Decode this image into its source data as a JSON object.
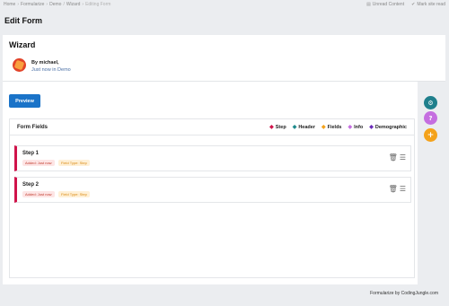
{
  "breadcrumb": [
    "Home",
    "Formularize",
    "Demo",
    "Wizard",
    "Editing Form"
  ],
  "topbar": {
    "unread": "Unread Content",
    "mark_read": "Mark site read"
  },
  "page_title": "Edit Form",
  "form": {
    "title": "Wizard",
    "author": "By michael,",
    "meta": "Just now in Demo"
  },
  "preview_label": "Preview",
  "fields_panel": {
    "title": "Form Fields",
    "legend": [
      {
        "label": "Step",
        "color": "#d0134a"
      },
      {
        "label": "Header",
        "color": "#1f8a8c"
      },
      {
        "label": "Fields",
        "color": "#f4a21b"
      },
      {
        "label": "Info",
        "color": "#c56ee0"
      },
      {
        "label": "Demographic",
        "color": "#6a2bb8"
      }
    ]
  },
  "steps": [
    {
      "label": "Step 1",
      "added": "Added: Just now",
      "type": "Field Type: Step"
    },
    {
      "label": "Step 2",
      "added": "Added: Just now",
      "type": "Field Type: Step"
    }
  ],
  "footer": "Formularize by CodingJungle.com"
}
